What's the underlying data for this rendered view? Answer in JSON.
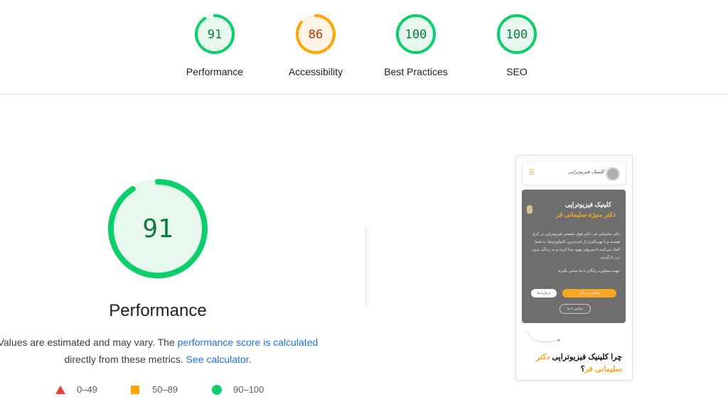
{
  "gauges": [
    {
      "score": "91",
      "label": "Performance",
      "color": "#0cce6b",
      "text_color": "#0a7a3f",
      "fill": "#e8f8ee",
      "value": 0.91
    },
    {
      "score": "86",
      "label": "Accessibility",
      "color": "#ffa400",
      "text_color": "#c33300",
      "fill": "#fff4e5",
      "value": 0.86
    },
    {
      "score": "100",
      "label": "Best Practices",
      "color": "#0cce6b",
      "text_color": "#0a7a3f",
      "fill": "#e8f8ee",
      "value": 1.0
    },
    {
      "score": "100",
      "label": "SEO",
      "color": "#0cce6b",
      "text_color": "#0a7a3f",
      "fill": "#e8f8ee",
      "value": 1.0
    }
  ],
  "main": {
    "score": "91",
    "value": 0.91,
    "title": "Performance",
    "desc_prefix": "Values are estimated and may vary. The ",
    "link_score": "performance score is calculated",
    "desc_mid": " directly from these metrics. ",
    "link_calc": "See calculator",
    "desc_end": "."
  },
  "legend": [
    {
      "range": "0–49",
      "icon": "fail-triangle-icon",
      "color": "#eb3e36"
    },
    {
      "range": "50–89",
      "icon": "average-square-icon",
      "color": "#ffa400"
    },
    {
      "range": "90–100",
      "icon": "pass-circle-icon",
      "color": "#0cce6b"
    }
  ],
  "screenshot": {
    "logo_text": "کلینیک فیزیوتراپی",
    "hero_title": "کلینیک فیزیوتراپی",
    "hero_subtitle": "دکتر منیژه سلیمانی فر",
    "hero_text": "دکتر سلیمانی فر، دکتر فوق تخصص فیزیوتراپی در کرج هستند و با بهره‌گیری از جدیدترین تکنولوژی‌ها، به شما کمک می‌کنند تا سریع‌تر بهبود پیدا کرده و به زندگی بدون درد بازگردید",
    "hero_text2": "جهت مشاوره رایگان با ما تماس بگیرید",
    "btn_consult": "مشاوره رایگان",
    "btn_about": "درباره ما",
    "btn_contact": "تماس با ما",
    "footer_q1": "چرا کلینیک فیزیوتراپی ",
    "footer_q2": "دکتر سلیمانی فر",
    "footer_q3": "؟"
  }
}
